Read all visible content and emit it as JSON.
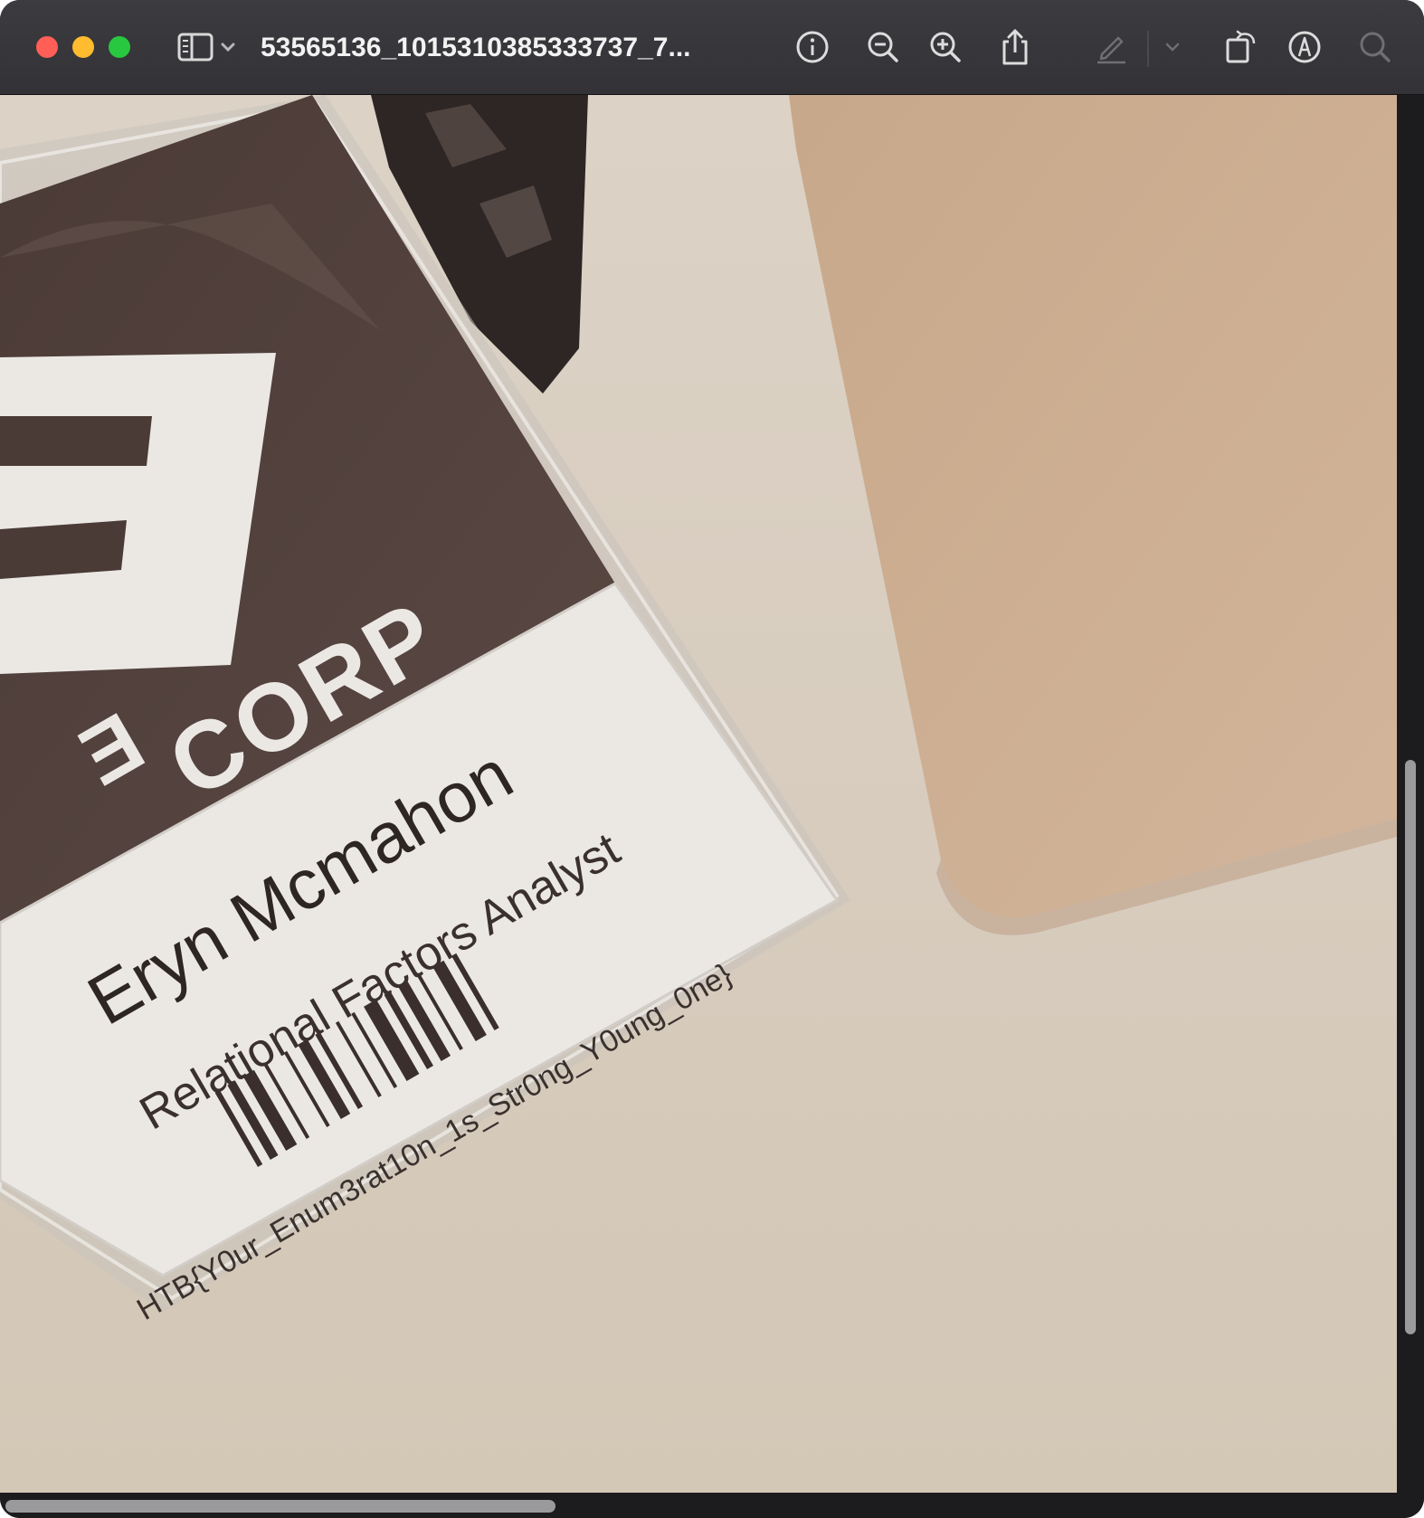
{
  "window": {
    "title": "53565136_1015310385333737_7...",
    "toolbar": {
      "sidebar_toggle_icon": "sidebar-icon",
      "info_icon": "info-icon",
      "zoom_out_icon": "zoom-out-icon",
      "zoom_in_icon": "zoom-in-icon",
      "share_icon": "share-icon",
      "markup_icon": "pencil-icon",
      "rotate_icon": "rotate-icon",
      "annotate_icon": "markup-circle-icon",
      "search_icon": "search-icon"
    }
  },
  "photo": {
    "badge": {
      "company": "CORP",
      "logo_letter": "E",
      "name": "Eryn Mcmahon",
      "role": "Relational Factors Analyst",
      "code": "HTB{Y0ur_Enum3rat10n_1s_Str0ng_Y0ung_0ne}"
    }
  },
  "colors": {
    "titlebar": "#3c3b3f",
    "badge_dark": "#4a3b37",
    "badge_light": "#e9e6e2",
    "desk": "#d8cec0",
    "tan_object": "#caa98b"
  }
}
